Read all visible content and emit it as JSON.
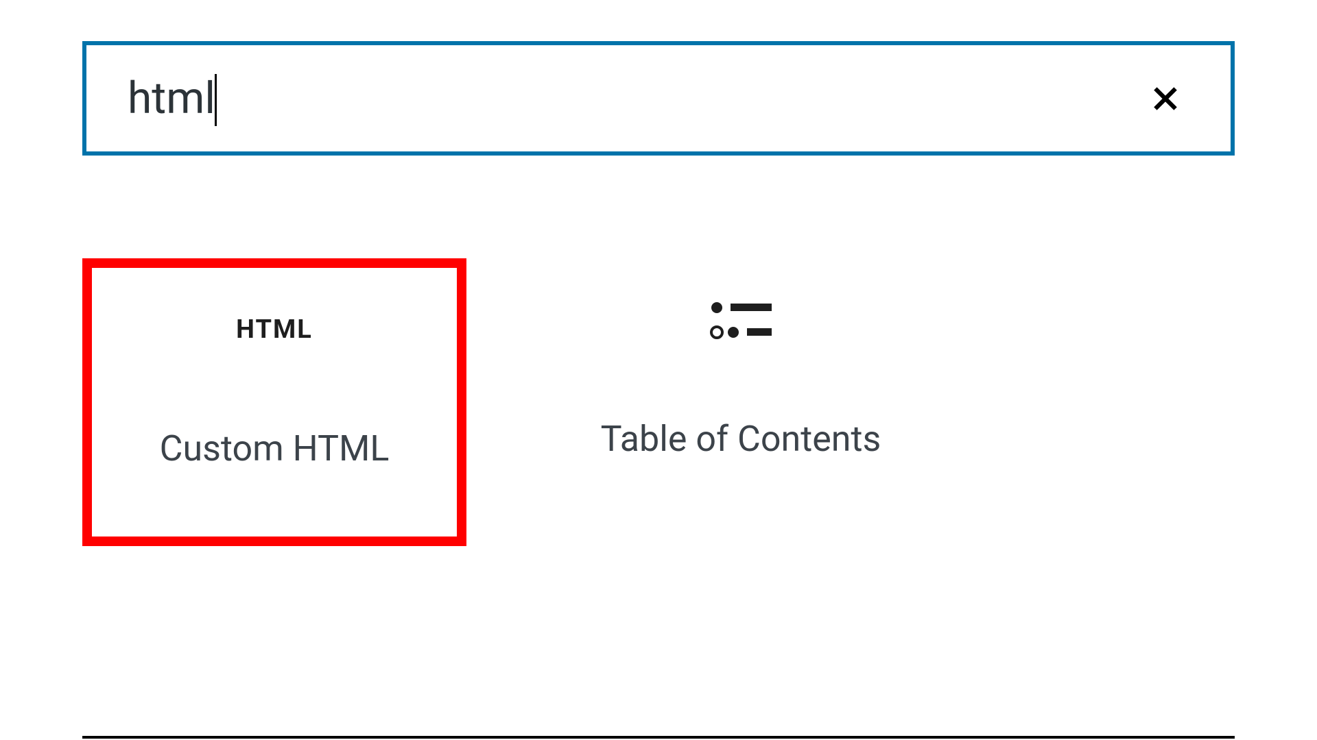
{
  "search": {
    "value": "html",
    "placeholder": ""
  },
  "blocks": [
    {
      "icon_text": "HTML",
      "label": "Custom HTML",
      "highlighted": true
    },
    {
      "icon_text": "",
      "label": "Table of Contents",
      "highlighted": false
    }
  ],
  "colors": {
    "search_border": "#0073aa",
    "highlight_border": "#ff0000"
  }
}
